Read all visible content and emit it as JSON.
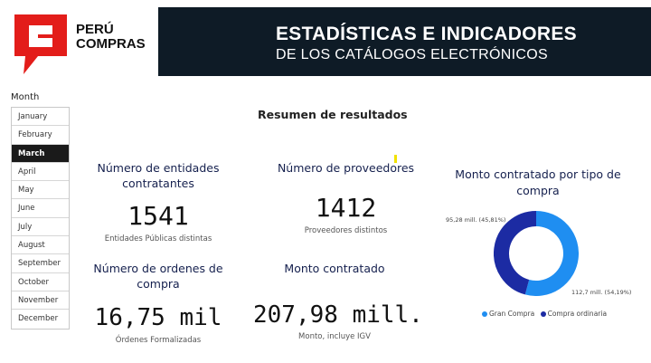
{
  "brand": {
    "line1": "PERÚ",
    "line2": "COMPRAS"
  },
  "header": {
    "title": "ESTADÍSTICAS E INDICADORES",
    "subtitle": "DE LOS CATÁLOGOS ELECTRÓNICOS"
  },
  "slicer": {
    "label": "Month",
    "months": [
      "January",
      "February",
      "March",
      "April",
      "May",
      "June",
      "July",
      "August",
      "September",
      "October",
      "November",
      "December"
    ],
    "selected": "March"
  },
  "summary_title": "Resumen de resultados",
  "kpis": {
    "entidades": {
      "title": "Número de entidades contratantes",
      "value": "1541",
      "sub": "Entidades Públicas distintas"
    },
    "proveedores": {
      "title": "Número de proveedores",
      "value": "1412",
      "sub": "Proveedores distintos"
    },
    "ordenes": {
      "title": "Número de ordenes de compra",
      "value": "16,75 mil",
      "sub": "Órdenes Formalizadas"
    },
    "monto": {
      "title": "Monto contratado",
      "value": "207,98 mill.",
      "sub": "Monto, incluye IGV"
    }
  },
  "chart_data": {
    "type": "pie",
    "title": "Monto contratado por tipo de compra",
    "series": [
      {
        "name": "Gran Compra",
        "value": 112.7,
        "label": "112,7 mill. (54,19%)",
        "color": "#1f8ef1"
      },
      {
        "name": "Compra ordinaria",
        "value": 95.28,
        "label": "95,28 mill. (45,81%)",
        "color": "#1c2ba3"
      }
    ]
  },
  "colors": {
    "brand_red": "#e31d1a",
    "header_bg": "#0e1b26",
    "kpi_title": "#15204e"
  }
}
